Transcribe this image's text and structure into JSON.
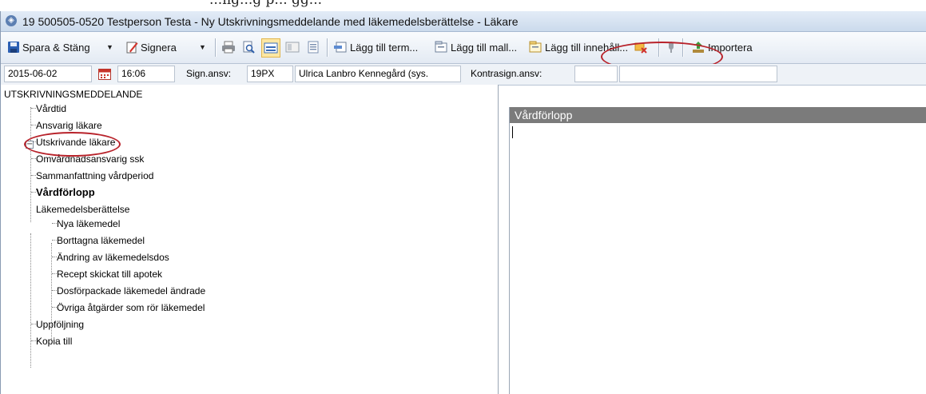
{
  "top_fragment": "...ng...g p... gg...",
  "window": {
    "title": "19 500505-0520 Testperson Testa - Ny Utskrivningsmeddelande med läkemedelsberättelse - Läkare"
  },
  "toolbar": {
    "save_close": "Spara & Stäng",
    "sign": "Signera",
    "add_term": "Lägg till term...",
    "add_template": "Lägg till mall...",
    "add_content": "Lägg till innehåll...",
    "import": "Importera"
  },
  "fields": {
    "date": "2015-06-02",
    "time": "16:06",
    "sign_label": "Sign.ansv:",
    "sign_code": "19PX",
    "sign_name": "Ulrica Lanbro Kennegård (sys.",
    "countersign_label": "Kontrasign.ansv:",
    "countersign_code": "",
    "countersign_name": ""
  },
  "tree": {
    "root": "UTSKRIVNINGSMEDDELANDE",
    "items": [
      "Vårdtid",
      "Ansvarig läkare",
      "Utskrivande läkare",
      "Omvårdnadsansvarig ssk",
      "Sammanfattning vårdperiod",
      "Vårdförlopp",
      "Läkemedelsberättelse"
    ],
    "children": [
      "Nya läkemedel",
      "Borttagna läkemedel",
      "Ändring av läkemedelsdos",
      "Recept skickat till apotek",
      "Dosförpackade läkemedel ändrade",
      "Övriga åtgärder som rör läkemedel"
    ],
    "after": [
      "Uppföljning",
      "Kopia till"
    ]
  },
  "editor": {
    "header": "Vårdförlopp"
  },
  "colors": {
    "highlight_ellipse": "#b8232b",
    "editor_header_bg": "#7b7b7b"
  }
}
